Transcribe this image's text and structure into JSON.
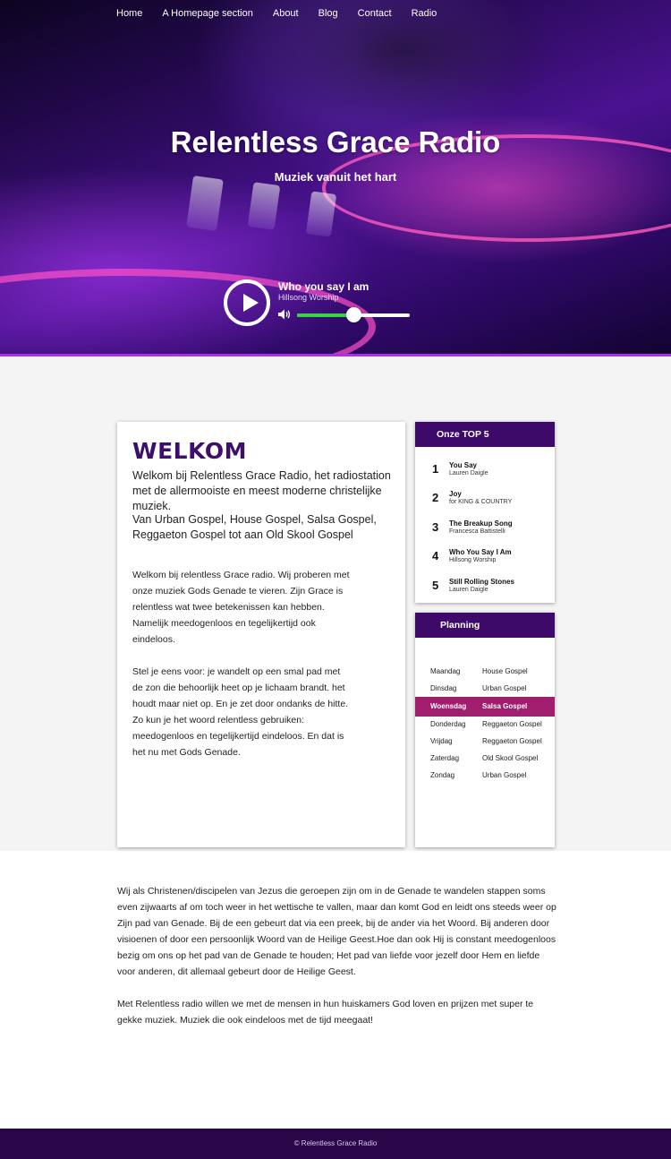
{
  "nav": {
    "items": [
      "Home",
      "A Homepage section",
      "About",
      "Blog",
      "Contact",
      "Radio"
    ]
  },
  "hero": {
    "title": "Relentless Grace Radio",
    "subtitle": "Muziek vanuit het hart"
  },
  "player": {
    "track_title": "Who you say I am",
    "track_artist": "Hillsong Worship",
    "volume_percent": 50,
    "play_icon": "play-icon",
    "volume_icon": "speaker-icon"
  },
  "welcome": {
    "heading": "WELKOM",
    "lead": "Welkom bij Relentless Grace Radio, het radiostation met de allermooiste en meest moderne christelijke muziek.",
    "lead2": "Van Urban Gospel, House Gospel, Salsa Gospel, Reggaeton Gospel tot aan Old Skool Gospel",
    "body1": "Welkom bij relentless Grace radio. Wij proberen met onze muziek Gods Genade te vieren. Zijn Grace is relentless wat twee betekenissen kan hebben. Namelijk meedogenloos en tegelijkertijd ook eindeloos.",
    "body2": "Stel je eens voor: je wandelt op een smal pad met de zon die behoorlijk heet op je lichaam brandt. het houdt maar niet op. En je zet door ondanks de hitte. Zo kun je het woord relentless gebruiken: meedogenloos en tegelijkertijd eindeloos. En dat is het nu met Gods Genade."
  },
  "top5": {
    "heading": "Onze TOP 5",
    "items": [
      {
        "num": "1",
        "title": "You Say",
        "artist": "Lauren Daigle"
      },
      {
        "num": "2",
        "title": "Joy",
        "artist": "for KING & COUNTRY"
      },
      {
        "num": "3",
        "title": "The Breakup Song",
        "artist": "Francesca Battistelli"
      },
      {
        "num": "4",
        "title": "Who You Say I Am",
        "artist": "Hillsong Worship"
      },
      {
        "num": "5",
        "title": "Still Rolling Stones",
        "artist": "Lauren Daigle"
      }
    ]
  },
  "planning": {
    "heading": "Planning",
    "rows": [
      {
        "day": "Maandag",
        "genre": "House Gospel",
        "active": false
      },
      {
        "day": "Dinsdag",
        "genre": "Urban Gospel",
        "active": false
      },
      {
        "day": "Woensdag",
        "genre": "Salsa Gospel",
        "active": true
      },
      {
        "day": "Donderdag",
        "genre": "Reggaeton Gospel",
        "active": false
      },
      {
        "day": "Vrijdag",
        "genre": "Reggaeton Gospel",
        "active": false
      },
      {
        "day": "Zaterdag",
        "genre": "Old Skool Gospel",
        "active": false
      },
      {
        "day": "Zondag",
        "genre": "Urban Gospel",
        "active": false
      }
    ]
  },
  "lower": {
    "para1": "Wij als Christenen/discipelen van Jezus die geroepen zijn om in de Genade te wandelen stappen soms even zijwaarts af om toch weer in het wettische te vallen, maar dan komt God en leidt ons steeds weer op Zijn pad van Genade. Bij de een gebeurt dat via een preek,  bij de ander via het Woord. Bij anderen door visioenen of door een persoonlijk Woord van de Heilige Geest.Hoe dan ook Hij is constant meedogenloos bezig om ons op het pad van de Genade te houden; Het pad van liefde voor jezelf door Hem en liefde voor anderen, dit allemaal gebeurt door de Heilige Geest.",
    "para2": "Met Relentless radio willen we met de mensen in hun huiskamers God loven en prijzen met super te gekke muziek. Muziek die ook eindeloos met de tijd meegaat!"
  },
  "footer": {
    "text": "© Relentless Grace Radio"
  },
  "colors": {
    "brand_purple": "#3d0a6a",
    "active_row": "#a11e6f",
    "volume_fill": "#35d63e",
    "footer_bg": "#2a0648"
  }
}
